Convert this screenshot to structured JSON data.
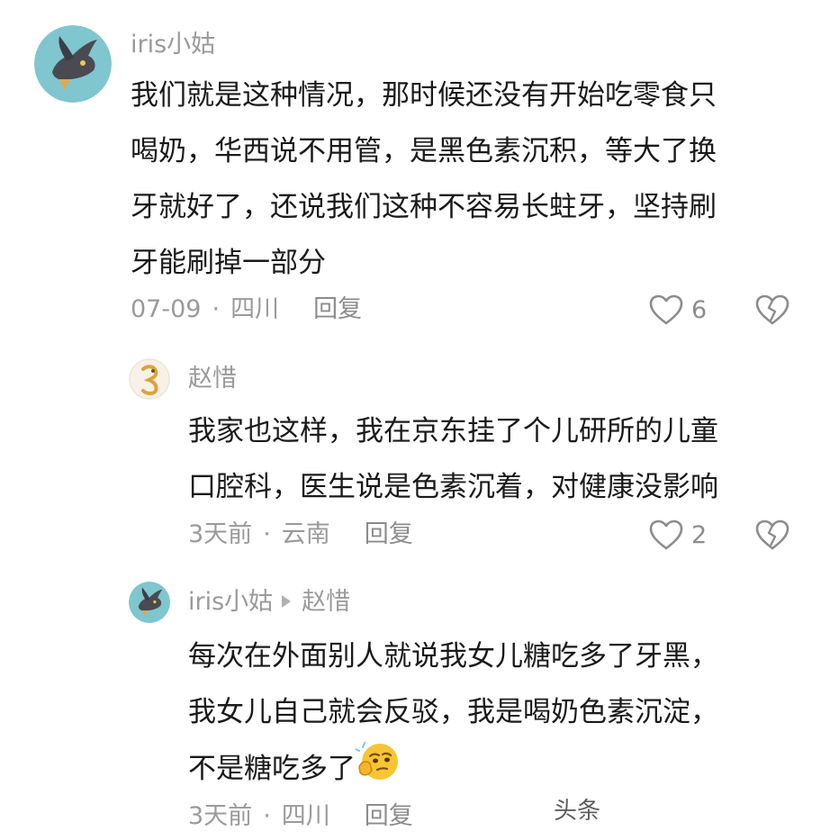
{
  "comments": [
    {
      "user": "iris小姑",
      "lines": [
        "我们就是这种情况，那时候还没有开始吃零食只",
        "喝奶，华西说不用管，是黑色素沉积，等大了换",
        "牙就好了，还说我们这种不容易长蛀牙，坚持刷",
        "牙能刷掉一部分"
      ],
      "date": "07-09",
      "location": "四川",
      "reply_label": "回复",
      "likes": "6"
    },
    {
      "user": "赵惜",
      "lines": [
        "我家也这样，我在京东挂了个儿研所的儿童",
        "口腔科，医生说是色素沉着，对健康没影响"
      ],
      "date": "3天前",
      "location": "云南",
      "reply_label": "回复",
      "likes": "2"
    },
    {
      "user": "iris小姑",
      "reply_to": "赵惜",
      "lines": [
        "每次在外面别人就说我女儿糖吃多了牙黑，",
        "我女儿自己就会反驳，我是喝奶色素沉淀，",
        "不是糖吃多了"
      ],
      "date": "3天前",
      "location": "四川",
      "reply_label": "回复"
    }
  ],
  "icons": {
    "like": "heart-outline-icon",
    "dislike": "broken-heart-icon",
    "emoji": "thinking-face-emoji"
  },
  "colors": {
    "text": "#1a1a1a",
    "meta": "#9a9a9a",
    "avatar_bg": "#7fc6cf"
  },
  "watermark": "头条"
}
